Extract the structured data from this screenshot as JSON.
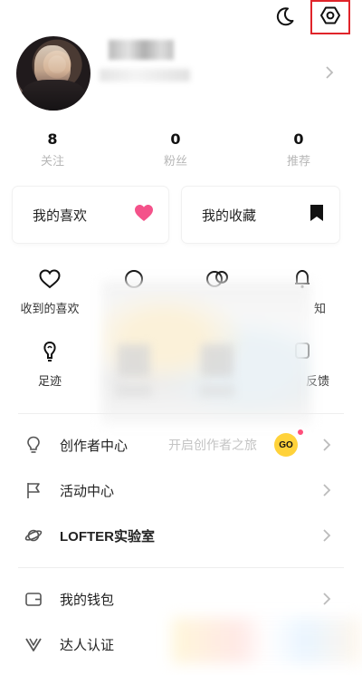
{
  "header": {
    "moon_icon": "moon-icon",
    "settings_icon": "settings-hexagon-icon",
    "highlight_color": "#e0242a"
  },
  "stats": [
    {
      "value": "8",
      "label": "关注"
    },
    {
      "value": "0",
      "label": "粉丝"
    },
    {
      "value": "0",
      "label": "推荐"
    }
  ],
  "cards": {
    "likes": {
      "label": "我的喜欢",
      "icon": "heart-icon",
      "color": "#f4528a"
    },
    "favorites": {
      "label": "我的收藏",
      "icon": "bookmark-icon",
      "color": "#111111"
    }
  },
  "grid": [
    {
      "label": "收到的喜欢",
      "icon": "heart-outline-icon"
    },
    {
      "label": "知",
      "icon": "bell-icon"
    },
    {
      "label": "足迹",
      "icon": "footprint-icon"
    },
    {
      "label": "反馈",
      "icon": "feedback-icon"
    }
  ],
  "menu": {
    "creator": {
      "label": "创作者中心",
      "hint": "开启创作者之旅",
      "badge": "GO"
    },
    "activity": {
      "label": "活动中心"
    },
    "lab": {
      "label": "LOFTER实验室"
    },
    "wallet": {
      "label": "我的钱包"
    },
    "verify": {
      "label": "达人认证"
    }
  }
}
